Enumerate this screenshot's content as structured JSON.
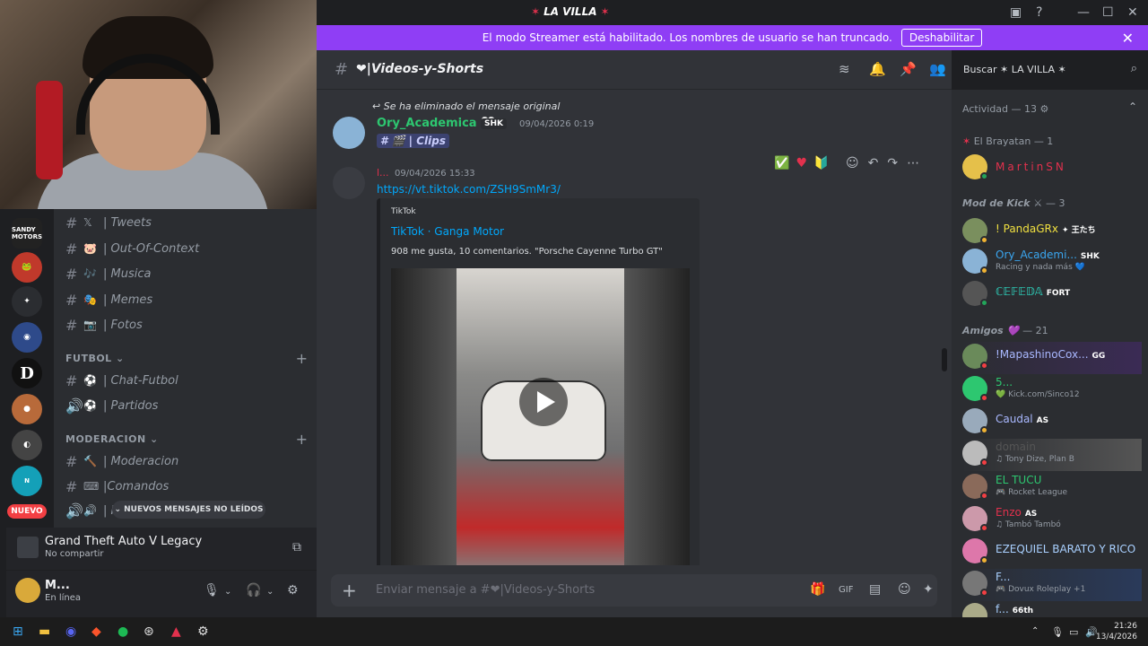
{
  "window": {
    "title": "LA VILLA"
  },
  "streamer": {
    "message": "El modo Streamer está habilitado. Los nombres de usuario se han truncado.",
    "button": "Deshabilitar"
  },
  "servers": {
    "nuevo_badge": "NUEVO",
    "sandy_label": "SANDY MOTORS"
  },
  "channels": {
    "items": [
      {
        "emoji": "𝕏",
        "label": "| Tweets"
      },
      {
        "emoji": "🐷",
        "label": "| Out-Of-Context"
      },
      {
        "emoji": "🎶",
        "label": "| Musica"
      },
      {
        "emoji": "🎭",
        "label": "| Memes"
      },
      {
        "emoji": "📷",
        "label": "| Fotos"
      }
    ],
    "cat_futbol": "FUTBOL",
    "futbol": [
      {
        "emoji": "⚽",
        "label": "| Chat-Futbol"
      },
      {
        "emoji": "⚽",
        "label": "| Partidos"
      }
    ],
    "cat_moderacion": "MODERACION",
    "moderacion": [
      {
        "emoji": "🔨",
        "label": "| Moderacion"
      },
      {
        "emoji": "⌨",
        "label": "|Comandos"
      },
      {
        "emoji": "🔊",
        "label": "| R"
      }
    ],
    "unread_pill": "NUEVOS MENSAJES NO LEÍDOS"
  },
  "activity": {
    "game": "Grand Theft Auto V Legacy",
    "sub": "No compartir"
  },
  "user": {
    "name": "M...",
    "status": "En línea"
  },
  "chat": {
    "channel_name": "❤|Videos-y-Shorts",
    "reply_note": "Se ha eliminado el mensaje original",
    "msg1": {
      "author": "Ory_Academica 🤍",
      "badge": "SHK",
      "time": "09/04/2026 0:19",
      "mention": "# 🎬 | Clips"
    },
    "msg2": {
      "author": "l...",
      "time": "09/04/2026 15:33",
      "link": "https://vt.tiktok.com/ZSH9SmMr3/"
    },
    "embed": {
      "provider": "TikTok",
      "title": "TikTok · Ganga Motor",
      "desc": "908 me gusta, 10 comentarios. \"Porsche Cayenne Turbo GT\""
    },
    "composer_placeholder": "Enviar mensaje a #❤|Videos-y-Shorts",
    "search_placeholder": "Buscar ✶ LA VILLA ✶"
  },
  "members": {
    "activity_header": "Actividad",
    "activity_count": "— 13 ⚙",
    "brayatan": {
      "label": "El Brayatan",
      "count": "— 1"
    },
    "modkick": {
      "label": "Mod de Kick ⚔",
      "count": "— 3"
    },
    "amigos": {
      "label": "Amigos 💜",
      "count": "— 21"
    },
    "list": [
      {
        "name": "MartinSN",
        "sub": "",
        "tag": "",
        "color": "#e2314d"
      },
      {
        "name": "! PandaGRx",
        "sub": "",
        "tag": "✦ 王たち",
        "color": "#f0e040"
      },
      {
        "name": "Ory_Academi...",
        "sub": "Racing y nada más 💙",
        "tag": "SHK",
        "color": "#3aa6f0"
      },
      {
        "name": "ℂ𝔼𝔽𝔼𝔻𝔸",
        "sub": "",
        "tag": "FORT",
        "color": "#2dd6c0"
      },
      {
        "name": "!MapashinoCox...",
        "sub": "",
        "tag": "GG",
        "color": "#a9b8ff"
      },
      {
        "name": "5...",
        "sub": "💚 Kick.com/Sinco12",
        "tag": "",
        "color": "#2dc770"
      },
      {
        "name": "Caudal",
        "sub": "",
        "tag": "AS",
        "color": "#a9b8ff"
      },
      {
        "name": "domain",
        "sub": "♫ Tony Dize, Plan B",
        "tag": "",
        "color": "#555"
      },
      {
        "name": "EL TUCU",
        "sub": "🎮 Rocket League",
        "tag": "",
        "color": "#2dc770"
      },
      {
        "name": "Enzo",
        "sub": "♫ Tambó Tambó",
        "tag": "AS",
        "color": "#e2314d"
      },
      {
        "name": "EZEQUIEL BARATO Y RICO",
        "sub": "",
        "tag": "",
        "color": "#a9d0ff"
      },
      {
        "name": "F...",
        "sub": "🎮 Dovux Roleplay +1",
        "tag": "",
        "color": "#a9d0ff"
      },
      {
        "name": "f...",
        "sub": "",
        "tag": "66th",
        "color": "#a9d0ff"
      }
    ]
  },
  "taskbar": {
    "time": "21:26",
    "date": "13/4/2026"
  }
}
